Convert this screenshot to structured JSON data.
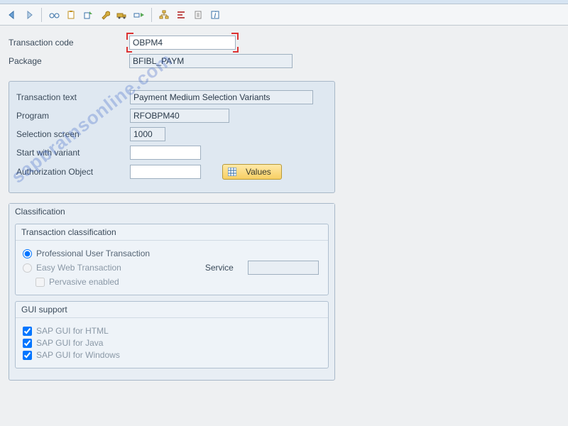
{
  "toolbar": {
    "icons": [
      "back",
      "forward",
      "glasses",
      "clipboard",
      "export",
      "wrench",
      "transport",
      "truck",
      "hierarchy",
      "align",
      "page",
      "info"
    ]
  },
  "header": {
    "tx_label": "Transaction code",
    "tx_value": "OBPM4",
    "pkg_label": "Package",
    "pkg_value": "BFIBL_PAYM"
  },
  "details": {
    "text_label": "Transaction text",
    "text_value": "Payment Medium Selection Variants",
    "prog_label": "Program",
    "prog_value": "RFOBPM40",
    "sel_label": "Selection screen",
    "sel_value": "1000",
    "variant_label": "Start with variant",
    "variant_value": "",
    "auth_label": "Authorization Object",
    "auth_value": "",
    "values_btn": "Values"
  },
  "classification": {
    "title": "Classification",
    "txclass": {
      "title": "Transaction classification",
      "pro": "Professional User Transaction",
      "easy": "Easy Web Transaction",
      "service_label": "Service",
      "service_value": "",
      "pervasive": "Pervasive enabled",
      "selected": "pro"
    },
    "gui": {
      "title": "GUI support",
      "html": "SAP GUI for HTML",
      "java": "SAP GUI for Java",
      "win": "SAP GUI for Windows",
      "html_checked": true,
      "java_checked": true,
      "win_checked": true
    }
  },
  "watermark": "sapbrainsonline.com"
}
